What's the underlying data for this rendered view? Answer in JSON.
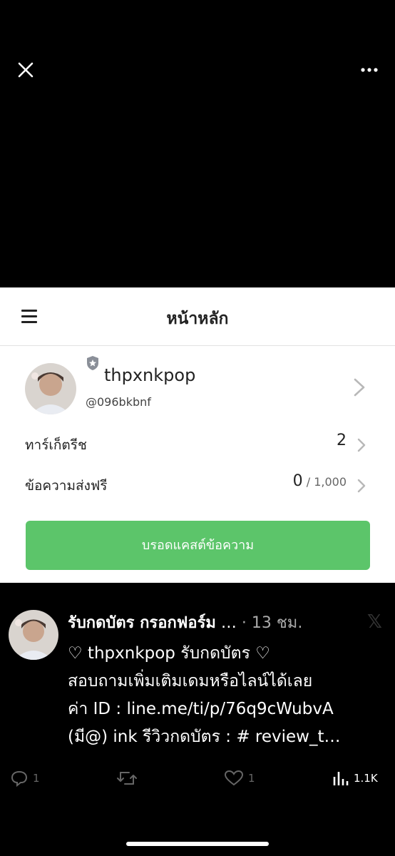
{
  "card": {
    "title": "หน้าหลัก",
    "profile": {
      "name": "thpxnkpop",
      "handle": "@096bkbnf"
    },
    "rows": [
      {
        "label": "ทาร์เก็ตรีช",
        "value": "2"
      },
      {
        "label": "ข้อความส่งฟรี",
        "value": "0",
        "suffix": " / 1,000"
      }
    ],
    "broadcast_label": "บรอดแคสต์ข้อความ"
  },
  "tweet": {
    "name": "รับกดบัตร กรอกฟอร์ม",
    "ellipsis": " …",
    "time": "· 13 ชม.",
    "x_logo": "𝕏",
    "lines": [
      "♡ thpxnkpop รับกดบัตร ♡",
      "สอบถามเพิ่มเติมเดมหรือไลน์ได้เลย",
      "ค่า ID : ",
      "(มี@) ink  รีวิวกดบัตร : # review_t…"
    ],
    "link": "line.me/ti/p/76q9cWubvA",
    "actions": {
      "reply_count": "1",
      "like_count": "1",
      "views_count": "1.1K"
    }
  },
  "icons": {
    "close": "close-icon",
    "more": "more-icon",
    "menu": "hamburger-icon",
    "shield": "shield-icon",
    "chevron": "chevron-right-icon",
    "reply": "reply-icon",
    "retweet": "retweet-icon",
    "like": "heart-icon",
    "views": "views-icon"
  },
  "colors": {
    "accent_green": "#5cc56a",
    "background": "#000000"
  }
}
